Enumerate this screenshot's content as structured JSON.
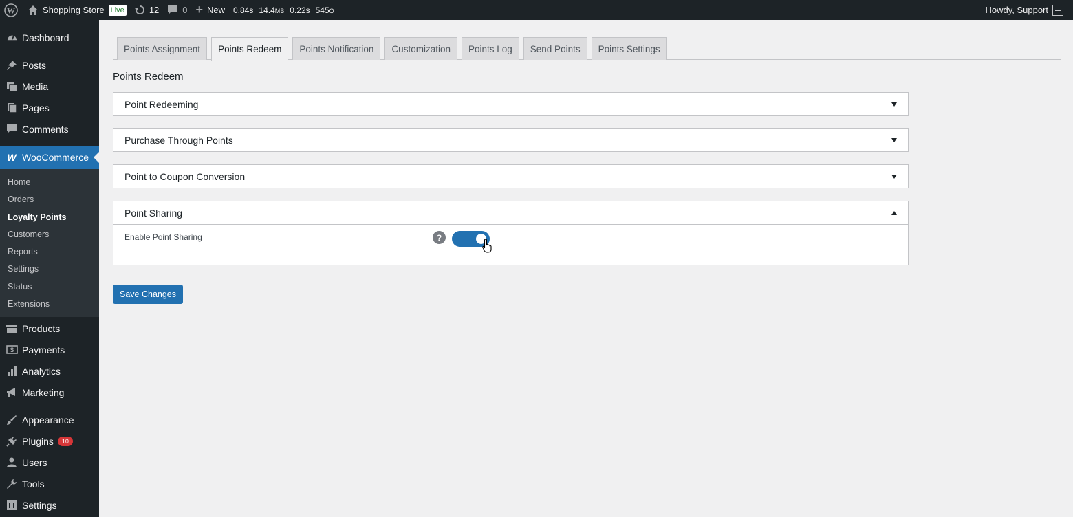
{
  "adminbar": {
    "site_name": "Shopping Store",
    "live_label": "Live",
    "updates_count": "12",
    "comments_count": "0",
    "new_label": "New",
    "perf_time": "0.84s",
    "perf_mem": "14.4",
    "perf_mem_unit": "MB",
    "perf_query_time": "0.22s",
    "perf_queries": "545",
    "perf_queries_unit": "Q",
    "howdy": "Howdy, Support"
  },
  "sidebar": {
    "dashboard": "Dashboard",
    "posts": "Posts",
    "media": "Media",
    "pages": "Pages",
    "comments": "Comments",
    "woocommerce": "WooCommerce",
    "woo_sub": [
      "Home",
      "Orders",
      "Loyalty Points",
      "Customers",
      "Reports",
      "Settings",
      "Status",
      "Extensions"
    ],
    "products": "Products",
    "payments": "Payments",
    "analytics": "Analytics",
    "marketing": "Marketing",
    "appearance": "Appearance",
    "plugins": "Plugins",
    "plugins_badge": "10",
    "users": "Users",
    "tools": "Tools",
    "settings": "Settings"
  },
  "tabs": [
    "Points Assignment",
    "Points Redeem",
    "Points Notification",
    "Customization",
    "Points Log",
    "Send Points",
    "Points Settings"
  ],
  "page_title": "Points Redeem",
  "sections": {
    "s1": "Point Redeeming",
    "s2": "Purchase Through Points",
    "s3": "Point to Coupon Conversion",
    "s4": "Point Sharing"
  },
  "point_sharing": {
    "enable_label": "Enable Point Sharing",
    "help": "?",
    "enabled": true
  },
  "save_button": "Save Changes",
  "colors": {
    "accent": "#2271b1",
    "sidebar_bg": "#1d2327",
    "badge": "#d63638"
  }
}
